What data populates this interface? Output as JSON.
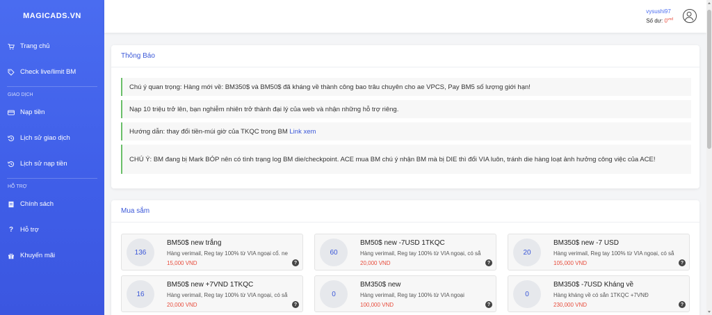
{
  "brand": "MAGICADS.VN",
  "sidebar": {
    "items_top": [
      {
        "label": "Trang chủ",
        "icon": "cart-icon"
      },
      {
        "label": "Check live/limit BM",
        "icon": "tag-icon"
      }
    ],
    "section_trade": "GIAO DỊCH",
    "items_trade": [
      {
        "label": "Nạp tiền",
        "icon": "credit-card-icon"
      },
      {
        "label": "Lịch sử giao dịch",
        "icon": "history-icon"
      },
      {
        "label": "Lịch sử nạp tiền",
        "icon": "history-icon"
      }
    ],
    "section_support": "HỖ TRỢ",
    "items_support": [
      {
        "label": "Chính sách",
        "icon": "document-icon"
      },
      {
        "label": "Hỗ trợ",
        "icon": "question-icon"
      },
      {
        "label": "Khuyến mãi",
        "icon": "gift-icon"
      }
    ]
  },
  "header": {
    "username": "vysushi97",
    "balance_label": "Số dư:",
    "balance_value": "0",
    "balance_unit": "vnđ"
  },
  "notify": {
    "title": "Thông Báo",
    "n1": "Chú ý quan trọng: Hàng mới về: BM350$ và BM50$ đã kháng về thành công bao trâu chuyên cho ae VPCS, Pay BM5 số lượng giới hạn!",
    "n2": "Nạp 10 triệu trở lên, bạn nghiễm nhiên trở thành đại lý của web và nhận những hỗ trợ riêng.",
    "n3_text": "Hướng dẫn: thay đổi tiền-múi giờ của TKQC trong BM",
    "n3_link": "Link xem",
    "n4": "CHÚ Ý: BM đang bị Mark BÓP nên có tình trạng log BM die/checkpoint. ACE mua BM chú ý nhận BM mà bị DIE thì đổi VIA luôn, tránh die hàng loạt ảnh hưởng công việc của ACE!"
  },
  "shop": {
    "title": "Mua sắm",
    "products": [
      {
        "qty": "136",
        "name": "BM50$ new trắng",
        "desc": "Hàng verimail, Reg tay 100% từ VIA ngoại cổ. ne",
        "price": "15,000 VND"
      },
      {
        "qty": "60",
        "name": "BM50$ new -7USD 1TKQC",
        "desc": "Hàng verimail, Reg tay 100% từ VIA ngoại, có sẵ",
        "price": "20,000 VND"
      },
      {
        "qty": "20",
        "name": "BM350$ new -7 USD",
        "desc": "Hàng verimail, Reg tay 100% từ VIA ngoại, có sẵ",
        "price": "105,000 VND"
      },
      {
        "qty": "16",
        "name": "BM50$ new +7VND 1TKQC",
        "desc": "Hàng verimail, Reg tay 100% từ VIA ngoại, có sẵ",
        "price": "20,000 VND"
      },
      {
        "qty": "0",
        "name": "BM350$ new",
        "desc": "Hàng verimail, Reg tay 100% từ VIA ngoại",
        "price": "100,000 VND"
      },
      {
        "qty": "0",
        "name": "BM350$ -7USD Kháng về",
        "desc": "Hàng kháng về có sẵn 1TKQC +7VNĐ",
        "price": "230,000 VND"
      }
    ],
    "help_glyph": "?"
  }
}
